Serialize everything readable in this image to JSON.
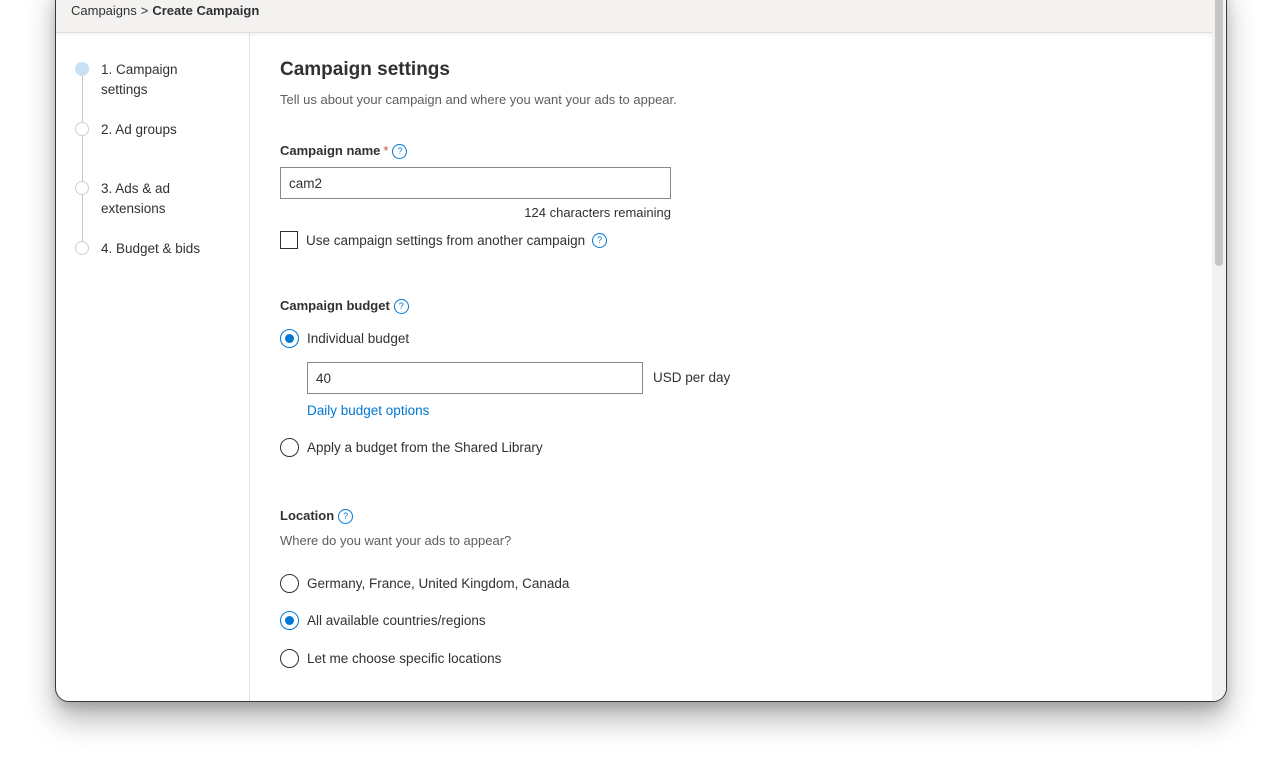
{
  "breadcrumb": {
    "root": "Campaigns",
    "separator": ">",
    "current": "Create Campaign"
  },
  "steps": [
    {
      "label": "1. Campaign settings",
      "state": "active"
    },
    {
      "label": "2. Ad groups",
      "state": "pending"
    },
    {
      "label": "3. Ads & ad extensions",
      "state": "pending"
    },
    {
      "label": "4. Budget & bids",
      "state": "pending"
    }
  ],
  "main": {
    "title": "Campaign settings",
    "subtitle": "Tell us about your campaign and where you want your ads to appear.",
    "campaign_name": {
      "label": "Campaign name",
      "required_mark": "*",
      "value": "cam2",
      "remaining": "124 characters remaining"
    },
    "copy_settings": {
      "label": "Use campaign settings from another campaign",
      "checked": false
    },
    "budget": {
      "label": "Campaign budget",
      "individual_label": "Individual budget",
      "amount": "40",
      "currency": "USD",
      "period": "per day",
      "options_link": "Daily budget options",
      "shared_label": "Apply a budget from the Shared Library",
      "selected": "individual"
    },
    "location": {
      "label": "Location",
      "question": "Where do you want your ads to appear?",
      "options": [
        "Germany, France, United Kingdom, Canada",
        "All available countries/regions",
        "Let me choose specific locations"
      ],
      "selected_index": 1
    }
  },
  "icons": {
    "help": "?"
  },
  "colors": {
    "accent": "#0078d4",
    "active_step": "#c7e0f4",
    "required": "#c0504d"
  }
}
